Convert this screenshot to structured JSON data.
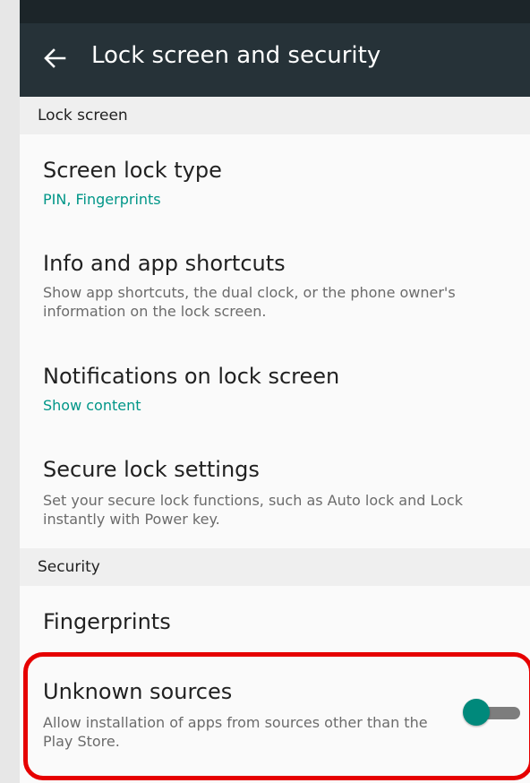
{
  "header": {
    "title": "Lock screen and security",
    "back_icon": "arrow-left-icon"
  },
  "sections": {
    "lock_screen": "Lock screen",
    "security": "Security"
  },
  "items": {
    "screen_lock_type": {
      "title": "Screen lock type",
      "subtitle": "PIN, Fingerprints"
    },
    "info_shortcuts": {
      "title": "Info and app shortcuts",
      "subtitle": "Show app shortcuts, the dual clock, or the phone owner's information on the lock screen."
    },
    "notifications": {
      "title": "Notifications on lock screen",
      "subtitle": "Show content"
    },
    "secure_lock": {
      "title": "Secure lock settings",
      "subtitle": "Set your secure lock functions, such as Auto lock and Lock instantly with Power key."
    },
    "fingerprints": {
      "title": "Fingerprints"
    },
    "unknown_sources": {
      "title": "Unknown sources",
      "subtitle": "Allow installation of apps from sources other than the Play Store.",
      "enabled": true
    }
  },
  "colors": {
    "appbar": "#263238",
    "accent": "#009688",
    "highlight": "#e60000"
  }
}
